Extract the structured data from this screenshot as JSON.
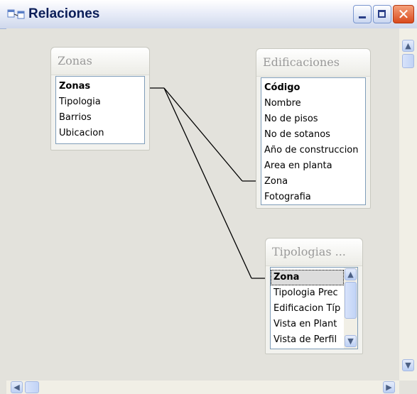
{
  "window": {
    "title": "Relaciones",
    "icon": "relationships-icon",
    "buttons": {
      "minimize": "_",
      "maximize": "□",
      "close": "✕"
    }
  },
  "tables": {
    "zonas": {
      "title": "Zonas",
      "fields": [
        "Zonas",
        "Tipologia",
        "Barrios",
        "Ubicacion"
      ],
      "key_field": "Zonas"
    },
    "edificaciones": {
      "title": "Edificaciones",
      "fields": [
        "Código",
        "Nombre",
        "No de pisos",
        "No de sotanos",
        "Año de construccion",
        "Area en planta",
        "Zona",
        "Fotografia"
      ],
      "key_field": "Código"
    },
    "tipologias": {
      "title": "Tipologias ...",
      "fields": [
        "Zona",
        "Tipologia Prec",
        "Edificacion Típ",
        "Vista en Plant",
        "Vista de Perfil"
      ],
      "key_field": "Zona",
      "selected_field": "Zona"
    }
  },
  "relationships": [
    {
      "from": "Zonas.Zonas",
      "to": "Edificaciones.Zona"
    },
    {
      "from": "Zonas.Zonas",
      "to": "Tipologias.Zona"
    }
  ],
  "colors": {
    "title_text": "#0b1e58",
    "close_button": "#d94a1d",
    "canvas": "#e3e2dc"
  }
}
